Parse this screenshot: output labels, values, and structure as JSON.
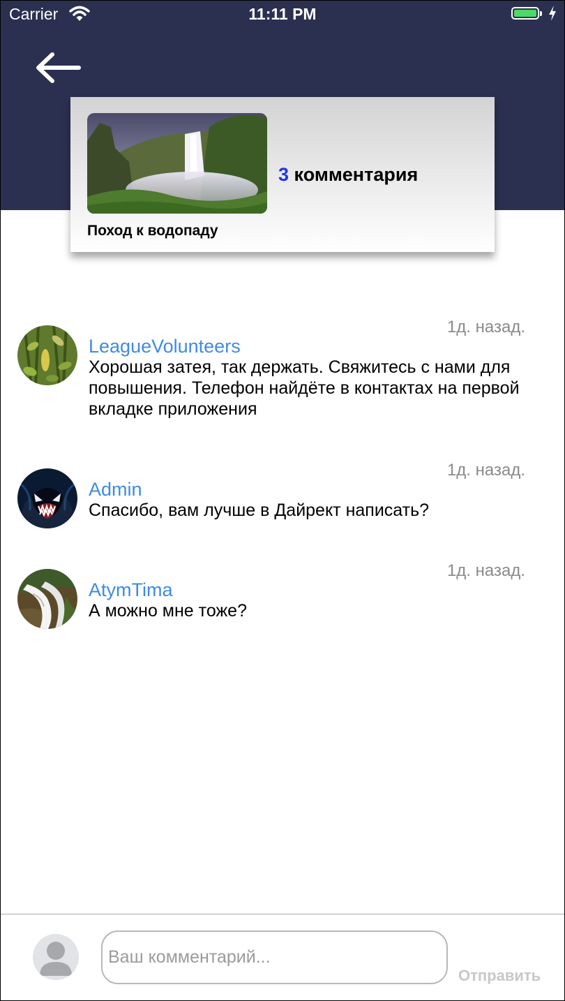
{
  "status_bar": {
    "carrier": "Carrier",
    "time": "11:11 PM"
  },
  "header": {
    "back_icon": "arrow-left-icon"
  },
  "post": {
    "title": "Поход к водопаду",
    "comment_count": "3",
    "comment_label": "комментария",
    "image": "waterfall-photo"
  },
  "comments": [
    {
      "author": "LeagueVolunteers",
      "time": "1д. назад.",
      "text": "Хорошая затея, так держать. Свяжитесь с нами для повышения. Телефон найдёте в контактах на первой вкладке приложения",
      "avatar": "plant-photo-avatar"
    },
    {
      "author": "Admin",
      "time": "1д. назад.",
      "text": "Спасибо, вам лучше в Дайрект написать?",
      "avatar": "venom-avatar"
    },
    {
      "author": "AtymTima",
      "time": "1д. назад.",
      "text": "А можно мне тоже?",
      "avatar": "waterfall-avatar"
    }
  ],
  "composer": {
    "placeholder": "Ваш комментарий...",
    "send_label": "Отправить",
    "user_icon": "user-placeholder-icon"
  },
  "colors": {
    "header_bg": "#2b3051",
    "name_link": "#3f8ae6",
    "count_accent": "#1e37e6",
    "timestamp": "#8a8a8e"
  }
}
